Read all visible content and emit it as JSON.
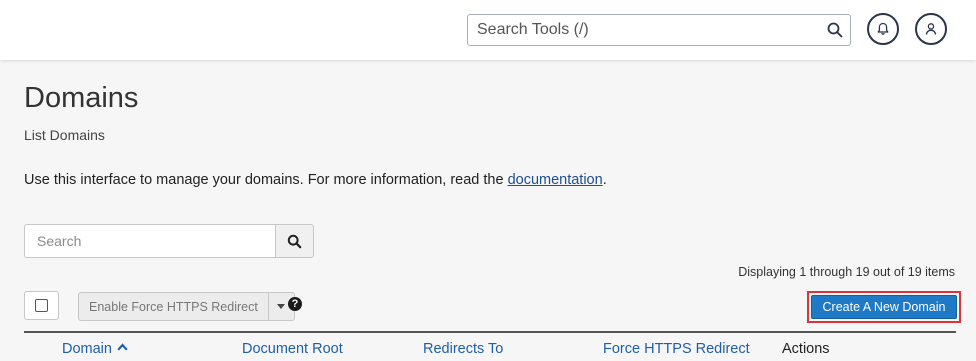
{
  "topbar": {
    "tool_search_placeholder": "Search Tools (/)",
    "search_icon": "search-icon",
    "notifications_icon": "bell-icon",
    "user_icon": "user-icon"
  },
  "page": {
    "title": "Domains",
    "subtitle": "List Domains",
    "intro_text": "Use this interface to manage your domains. For more information, read the ",
    "intro_link": "documentation",
    "intro_end": "."
  },
  "list": {
    "search_placeholder": "Search",
    "search_button_icon": "search-icon",
    "displaying": "Displaying 1 through 19 out of 19 items",
    "bulk_action_label": "Enable Force HTTPS Redirect",
    "help_icon": "question-circle-icon",
    "create_button": "Create A New Domain",
    "columns": [
      {
        "label": "Domain",
        "sorted": "ascending"
      },
      {
        "label": "Document Root"
      },
      {
        "label": "Redirects To"
      },
      {
        "label": "Force HTTPS Redirect"
      },
      {
        "label": "Actions"
      }
    ]
  },
  "colors": {
    "accent": "#1e79c6",
    "highlight_border": "#d9343b",
    "link": "#1f5fa7"
  }
}
